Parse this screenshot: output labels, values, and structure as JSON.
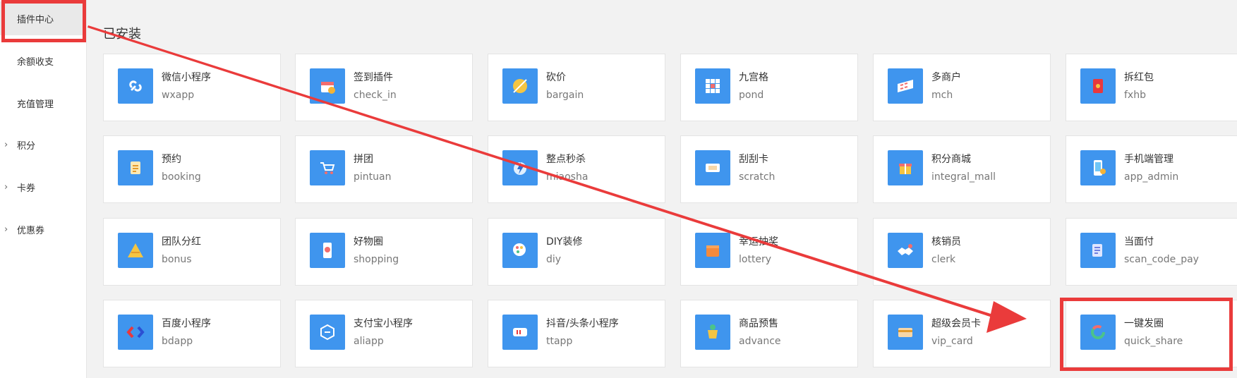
{
  "sidebar": {
    "items": [
      {
        "label": "插件中心",
        "chevron": false,
        "active": true
      },
      {
        "label": "余额收支",
        "chevron": false,
        "active": false
      },
      {
        "label": "充值管理",
        "chevron": false,
        "active": false
      },
      {
        "label": "积分",
        "chevron": true,
        "active": false
      },
      {
        "label": "卡券",
        "chevron": true,
        "active": false
      },
      {
        "label": "优惠券",
        "chevron": true,
        "active": false
      }
    ]
  },
  "section_title": "已安装",
  "plugins": [
    {
      "name": "微信小程序",
      "code": "wxapp",
      "icon": "link-icon"
    },
    {
      "name": "签到插件",
      "code": "check_in",
      "icon": "calendar-gift-icon"
    },
    {
      "name": "砍价",
      "code": "bargain",
      "icon": "coin-cut-icon"
    },
    {
      "name": "九宫格",
      "code": "pond",
      "icon": "grid-icon"
    },
    {
      "name": "多商户",
      "code": "mch",
      "icon": "storefront-icon"
    },
    {
      "name": "拆红包",
      "code": "fxhb",
      "icon": "red-envelope-icon"
    },
    {
      "name": "预约",
      "code": "booking",
      "icon": "clipboard-icon"
    },
    {
      "name": "拼团",
      "code": "pintuan",
      "icon": "shopping-cart-icon"
    },
    {
      "name": "整点秒杀",
      "code": "miaosha",
      "icon": "lightning-icon"
    },
    {
      "name": "刮刮卡",
      "code": "scratch",
      "icon": "scratch-card-icon"
    },
    {
      "name": "积分商城",
      "code": "integral_mall",
      "icon": "gift-shop-icon"
    },
    {
      "name": "手机端管理",
      "code": "app_admin",
      "icon": "phone-admin-icon"
    },
    {
      "name": "团队分红",
      "code": "bonus",
      "icon": "pyramid-icon"
    },
    {
      "name": "好物圈",
      "code": "shopping",
      "icon": "phone-share-icon"
    },
    {
      "name": "DIY装修",
      "code": "diy",
      "icon": "paint-icon"
    },
    {
      "name": "幸运抽奖",
      "code": "lottery",
      "icon": "lottery-box-icon"
    },
    {
      "name": "核销员",
      "code": "clerk",
      "icon": "handshake-icon"
    },
    {
      "name": "当面付",
      "code": "scan_code_pay",
      "icon": "scan-pay-icon"
    },
    {
      "name": "百度小程序",
      "code": "bdapp",
      "icon": "baidu-logo-icon"
    },
    {
      "name": "支付宝小程序",
      "code": "aliapp",
      "icon": "alipay-logo-icon"
    },
    {
      "name": "抖音/头条小程序",
      "code": "ttapp",
      "icon": "tiktok-logo-icon"
    },
    {
      "name": "商品预售",
      "code": "advance",
      "icon": "presale-icon"
    },
    {
      "name": "超级会员卡",
      "code": "vip_card",
      "icon": "vip-card-icon"
    },
    {
      "name": "一键发圈",
      "code": "quick_share",
      "icon": "circle-share-icon"
    }
  ],
  "colors": {
    "tile": "#3f95ee",
    "highlight": "#ea3b3b"
  }
}
